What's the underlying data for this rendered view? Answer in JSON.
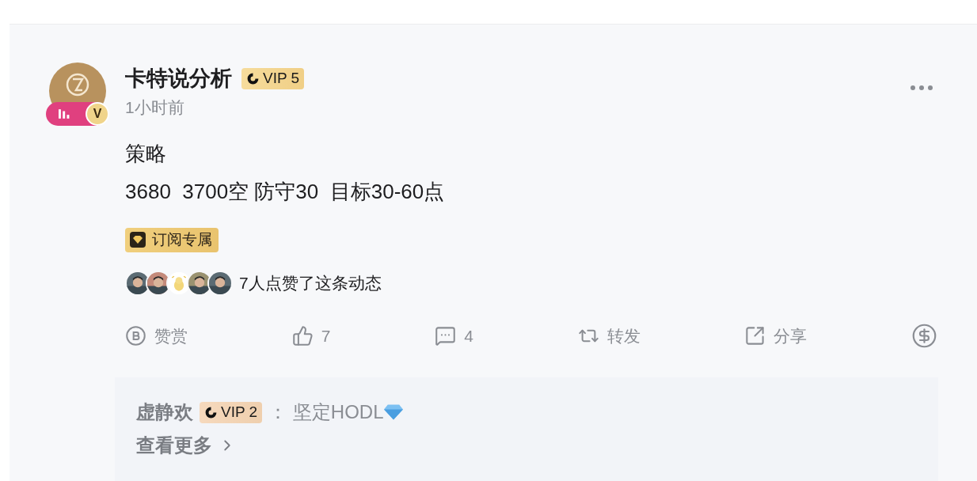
{
  "post": {
    "author": "卡特说分析",
    "vip_badge": "VIP 5",
    "time": "1小时前",
    "avatar": {
      "kind": "picture",
      "live": true,
      "verified_mark": "V"
    },
    "content": [
      "策略",
      "3680  3700空 防守30  目标30-60点"
    ],
    "tag": "订阅专属",
    "liker_avatars": [
      {
        "kind": "picture"
      },
      {
        "kind": "picture"
      },
      {
        "kind": "sticker"
      },
      {
        "kind": "picture"
      },
      {
        "kind": "picture"
      }
    ],
    "likes_text": "7人点赞了这条动态",
    "actions": [
      {
        "kind": "reward",
        "label": "赞赏"
      },
      {
        "kind": "like",
        "label": "7"
      },
      {
        "kind": "comment",
        "label": "4"
      },
      {
        "kind": "repost",
        "label": "转发"
      },
      {
        "kind": "share",
        "label": "分享"
      },
      {
        "kind": "tip"
      }
    ],
    "comments": [
      {
        "author": "虚静欢",
        "vip_badge": "VIP 2",
        "separator": "：",
        "text": "坚定HODL",
        "gem_emoji": true
      }
    ],
    "more": "查看更多"
  }
}
